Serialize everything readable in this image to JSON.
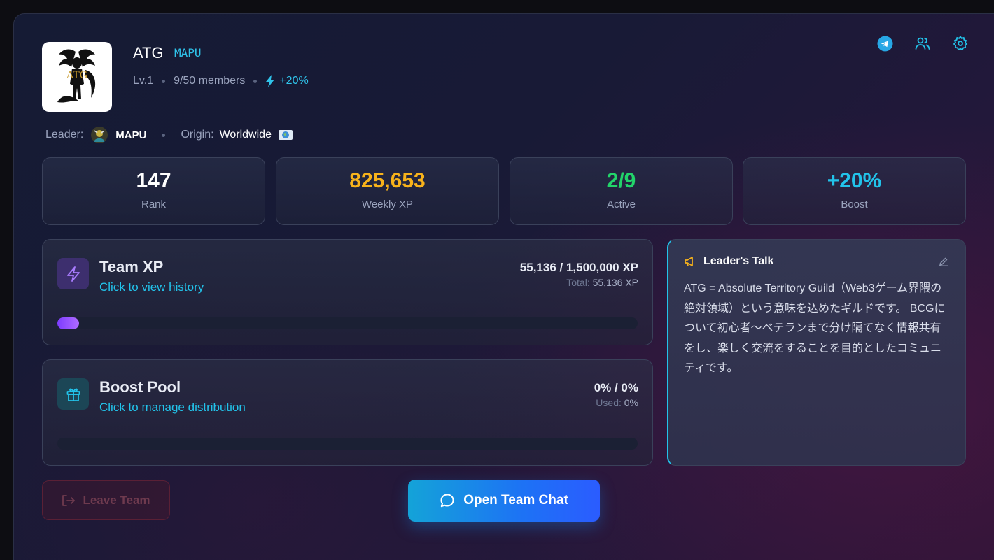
{
  "team": {
    "name": "ATG",
    "tag": "MAPU",
    "level": "Lv.1",
    "members": "9/50 members",
    "boost": "+20%"
  },
  "leader_row": {
    "leader_label": "Leader:",
    "leader_name": "MAPU",
    "origin_label": "Origin:",
    "origin_value": "Worldwide"
  },
  "stats": [
    {
      "value": "147",
      "label": "Rank",
      "color": "#ffffff"
    },
    {
      "value": "825,653",
      "label": "Weekly XP",
      "color": "#f7b21b"
    },
    {
      "value": "2/9",
      "label": "Active",
      "color": "#22d46a"
    },
    {
      "value": "+20%",
      "label": "Boost",
      "color": "#22c3ea"
    }
  ],
  "team_xp": {
    "title": "Team XP",
    "subtitle": "Click to view history",
    "value": "55,136 / 1,500,000 XP",
    "total_label": "Total:",
    "total_value": "55,136 XP",
    "progress_fraction": 0.0368
  },
  "boost_pool": {
    "title": "Boost Pool",
    "subtitle": "Click to manage distribution",
    "value": "0% / 0%",
    "used_label": "Used:",
    "used_value": "0%",
    "progress_fraction": 0
  },
  "leaders_talk": {
    "title": "Leader's Talk",
    "body": "ATG = Absolute Territory Guild（Web3ゲーム界隈の絶対領域）という意味を込めたギルドです。 BCGについて初心者〜ベテランまで分け隔てなく情報共有をし、楽しく交流をすることを目的としたコミュニティです。"
  },
  "actions": {
    "leave": "Leave Team",
    "chat": "Open Team Chat"
  },
  "icons": {
    "telegram": "telegram-icon",
    "members": "users-icon",
    "settings": "gear-icon",
    "bolt": "lightning-icon",
    "gift": "gift-icon",
    "megaphone": "megaphone-icon",
    "edit": "pencil-icon",
    "logout": "logout-icon",
    "chat": "chat-bubble-icon"
  },
  "colors": {
    "accent": "#22c3ea",
    "xp_fill": "#7d3cff"
  }
}
